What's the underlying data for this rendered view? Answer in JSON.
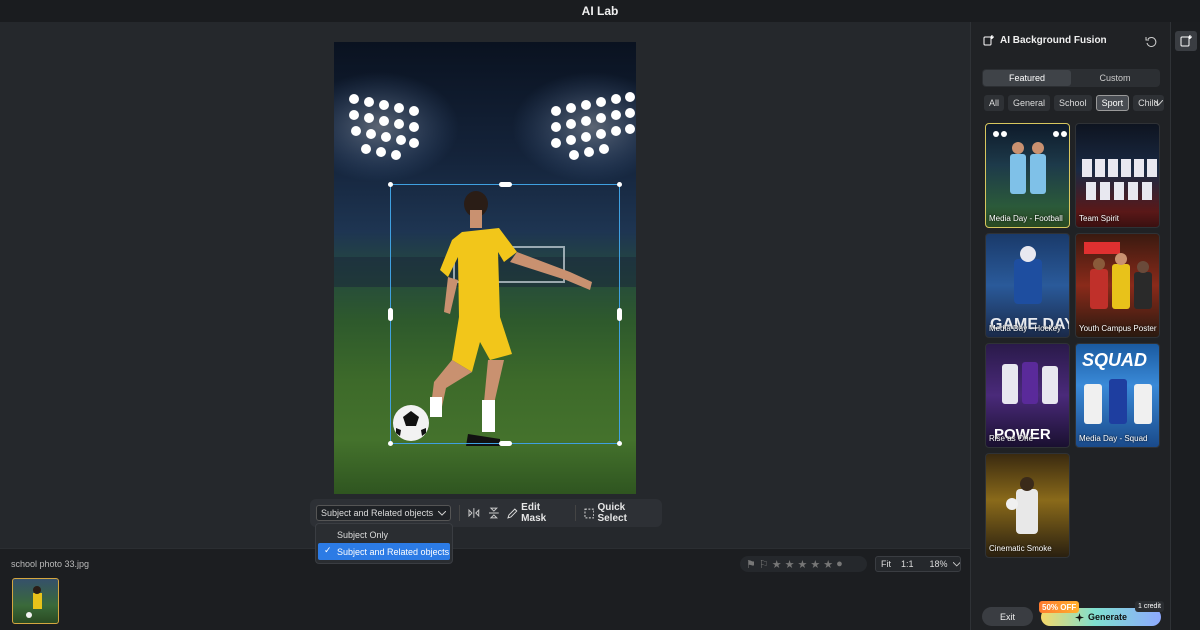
{
  "app": {
    "title": "AI Lab"
  },
  "toolbar": {
    "mode_select": "Subject and Related objects",
    "edit_mask": "Edit Mask",
    "quick_select": "Quick Select"
  },
  "mode_dropdown": {
    "options": [
      "Subject Only",
      "Subject and Related objects"
    ],
    "selected": "Subject and Related objects"
  },
  "filmstrip": {
    "filename": "school photo 33.jpg"
  },
  "rating": {
    "stars": 5
  },
  "zoom": {
    "fit": "Fit",
    "one_to_one": "1:1",
    "level": "18%"
  },
  "panel": {
    "title": "AI Background Fusion",
    "tabs": [
      "Featured",
      "Custom"
    ],
    "active_tab": "Featured",
    "categories": [
      "All",
      "General",
      "School",
      "Sport",
      "Child"
    ],
    "active_category": "Sport",
    "templates": [
      {
        "label": "Media Day - Football",
        "selected": true
      },
      {
        "label": "Team Spirit"
      },
      {
        "label": "Media Day - Hockey"
      },
      {
        "label": "Youth Campus Poster"
      },
      {
        "label": "Rise as One"
      },
      {
        "label": "Media Day - Squad"
      },
      {
        "label": "Cinematic Smoke"
      }
    ]
  },
  "footer": {
    "exit": "Exit",
    "generate": "Generate",
    "promo": "50% OFF",
    "credit": "1 credit"
  },
  "colors": {
    "accent": "#2c7be5",
    "selection_border": "#3fa0e0",
    "selected_card": "#d7c65e"
  }
}
